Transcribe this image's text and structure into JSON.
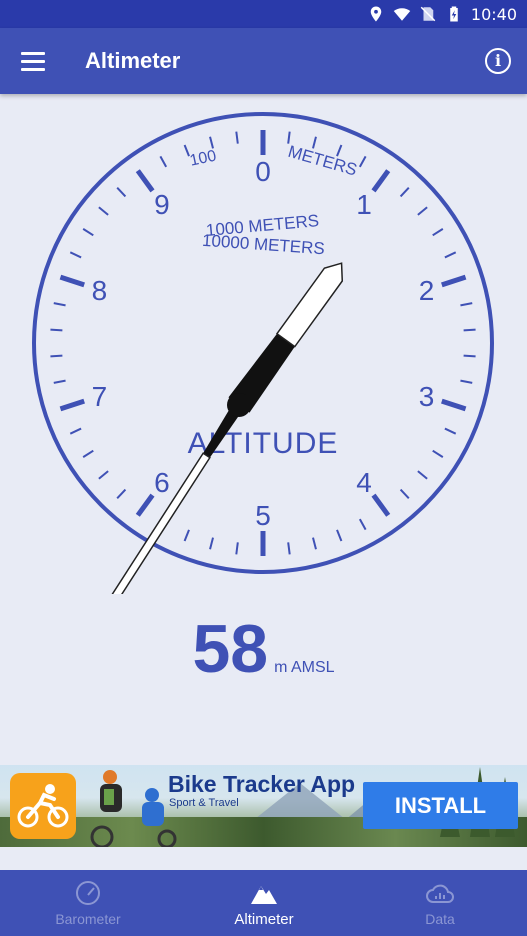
{
  "status_bar": {
    "time": "10:40",
    "icons": [
      "location-icon",
      "wifi-icon",
      "no-sim-icon",
      "battery-charging-icon"
    ]
  },
  "app_bar": {
    "title": "Altimeter",
    "menu_icon": "menu-icon",
    "info_icon": "info-icon"
  },
  "gauge": {
    "dial_numbers": [
      "0",
      "1",
      "2",
      "3",
      "4",
      "5",
      "6",
      "7",
      "8",
      "9"
    ],
    "label_100": "100",
    "label_meters": "METERS",
    "label_1000": "1000 METERS",
    "label_10000": "10000 METERS",
    "label_altitude": "ALTITUDE",
    "altitude_m": 58,
    "color": "#3f51b5"
  },
  "reading": {
    "value": "58",
    "unit": "m AMSL"
  },
  "ad": {
    "title": "Bike Tracker App",
    "subtitle": "Sport & Travel",
    "button": "INSTALL"
  },
  "bottom_nav": {
    "items": [
      {
        "label": "Barometer",
        "icon": "gauge-icon",
        "active": false
      },
      {
        "label": "Altimeter",
        "icon": "mountain-icon",
        "active": true
      },
      {
        "label": "Data",
        "icon": "cloud-chart-icon",
        "active": false
      }
    ]
  },
  "colors": {
    "primary": "#3f51b5",
    "status_bar": "#2a3aaa",
    "background": "#e8ebf5",
    "ad_button": "#2f7ce8",
    "ad_icon": "#f7a21b"
  }
}
